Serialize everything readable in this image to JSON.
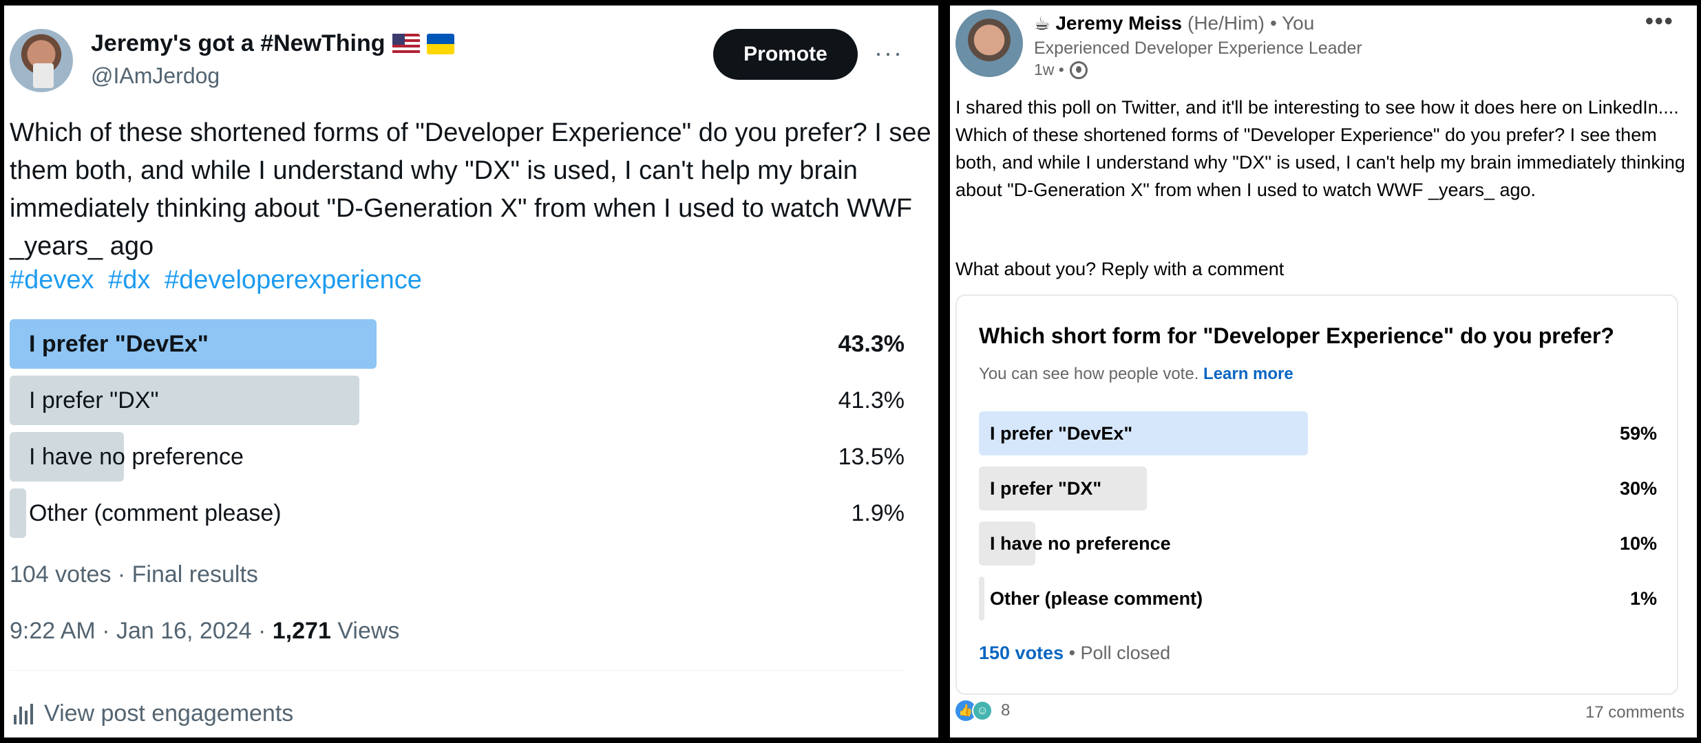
{
  "twitter": {
    "author_name": "Jeremy's got a #NewThing",
    "handle": "@IAmJerdog",
    "promote_label": "Promote",
    "more_label": "···",
    "body": "Which of these shortened forms of \"Developer Experience\" do you prefer? I see them both, and while I understand why \"DX\" is used, I can't help my brain immediately thinking about \"D-Generation X\" from when I used to watch WWF _years_ ago",
    "hashtags": [
      "#devex",
      "#dx",
      "#developerexperience"
    ],
    "poll": {
      "options": [
        {
          "label": "I prefer \"DevEx\"",
          "percent_text": "43.3%",
          "value": 43.3,
          "winner": true
        },
        {
          "label": "I prefer \"DX\"",
          "percent_text": "41.3%",
          "value": 41.3,
          "winner": false
        },
        {
          "label": "I have no preference",
          "percent_text": "13.5%",
          "value": 13.5,
          "winner": false
        },
        {
          "label": "Other (comment please)",
          "percent_text": "1.9%",
          "value": 1.9,
          "winner": false
        }
      ],
      "votes_text": "104 votes · Final results"
    },
    "timestamp": "9:22 AM · Jan 16, 2024 · ",
    "views_count": "1,271",
    "views_label": " Views",
    "engagements_label": "View post engagements",
    "colors": {
      "accent": "#1d9bf0",
      "winner_fill": "#8ec5f4",
      "fill": "#cfd9de",
      "text": "#0f1419",
      "muted": "#536471"
    }
  },
  "linkedin": {
    "coffee_icon": "☕",
    "author_name": "Jeremy Meiss",
    "pronouns": "(He/Him)",
    "relation": "• You",
    "headline": "Experienced Developer Experience Leader",
    "time": "1w •",
    "more_label": "•••",
    "body": "I shared this poll on Twitter, and it'll be interesting to see how it does here on LinkedIn.... Which of these shortened forms of \"Developer Experience\" do you prefer? I see them both, and while I understand why \"DX\" is used, I can't help my brain immediately thinking about \"D-Generation X\" from when I used to watch WWF _years_ ago.",
    "ask": "What about you? Reply with a comment",
    "poll": {
      "question": "Which short form for \"Developer Experience\" do you prefer?",
      "note": "You can see how people vote.",
      "learn_more": "Learn more",
      "options": [
        {
          "label": "I prefer \"DevEx\"",
          "percent_text": "59%",
          "value": 59,
          "winner": true
        },
        {
          "label": "I prefer \"DX\"",
          "percent_text": "30%",
          "value": 30,
          "winner": false
        },
        {
          "label": "I have no preference",
          "percent_text": "10%",
          "value": 10,
          "winner": false
        },
        {
          "label": "Other (please comment)",
          "percent_text": "1%",
          "value": 1,
          "winner": false
        }
      ],
      "votes": "150 votes",
      "status": " • Poll closed"
    },
    "reactions_count": "8",
    "comments": "17 comments",
    "colors": {
      "link": "#0a66c2",
      "winner_fill": "#d6e7fb",
      "fill": "#e8e8e8"
    }
  }
}
